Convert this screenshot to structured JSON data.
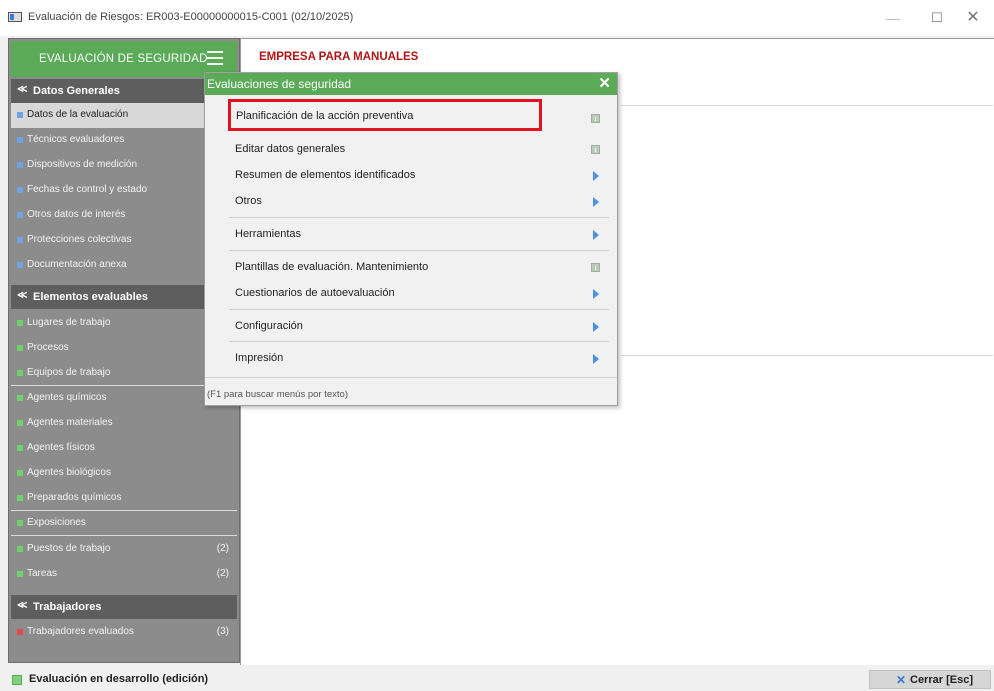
{
  "window": {
    "title": "Evaluación de Riesgos: ER003-E00000000015-C001  (02/10/2025)",
    "minimize": "—",
    "maximize": "☐",
    "close": "✕"
  },
  "sidebar": {
    "header_label": "EVALUACIÓN DE SEGURIDAD",
    "sections": {
      "datos_generales": "Datos Generales",
      "elementos": "Elementos evaluables",
      "trabajadores": "Trabajadores"
    },
    "chevron": "≪",
    "datos_generales_items": [
      {
        "label": "Datos de la evaluación",
        "color": "#6fa3e6"
      },
      {
        "label": "Técnicos evaluadores",
        "color": "#6fa3e6"
      },
      {
        "label": "Dispositivos de medición",
        "color": "#6fa3e6"
      },
      {
        "label": "Fechas de control y estado",
        "color": "#6fa3e6"
      },
      {
        "label": "Otros datos de interés",
        "color": "#6fa3e6"
      },
      {
        "label": "Protecciones colectivas",
        "color": "#6fa3e6"
      },
      {
        "label": "Documentación anexa",
        "color": "#6fa3e6"
      }
    ],
    "elementos_items": [
      {
        "label": "Lugares de trabajo",
        "count": ""
      },
      {
        "label": "Procesos",
        "count": ""
      },
      {
        "label": "Equipos de trabajo",
        "count": ""
      },
      {
        "label": "Agentes químicos",
        "count": ""
      },
      {
        "label": "Agentes materiales",
        "count": ""
      },
      {
        "label": "Agentes físicos",
        "count": ""
      },
      {
        "label": "Agentes biológicos",
        "count": ""
      },
      {
        "label": "Preparados químicos",
        "count": ""
      },
      {
        "label": "Exposiciones",
        "count": ""
      },
      {
        "label": "Puestos de trabajo",
        "count": "(2)"
      },
      {
        "label": "Tareas",
        "count": "(2)"
      }
    ],
    "trabajadores_items": [
      {
        "label": "Trabajadores evaluados",
        "count": "(3)"
      }
    ]
  },
  "main": {
    "company": "EMPRESA PARA MANUALES"
  },
  "popup": {
    "title": "Evaluaciones de seguridad",
    "close": "✕",
    "items": [
      {
        "label": "Planificación de la acción preventiva",
        "icon": "document-icon"
      },
      {
        "label": "Editar datos generales",
        "icon": "document-icon"
      },
      {
        "label": "Resumen de elementos identificados",
        "icon": "submenu-arrow-icon"
      },
      {
        "label": "Otros",
        "icon": "submenu-arrow-icon"
      },
      {
        "label": "Herramientas",
        "icon": "submenu-arrow-icon"
      },
      {
        "label": "Plantillas de evaluación. Mantenimiento",
        "icon": "document-icon"
      },
      {
        "label": "Cuestionarios de autoevaluación",
        "icon": "submenu-arrow-icon"
      },
      {
        "label": "Configuración",
        "icon": "submenu-arrow-icon"
      },
      {
        "label": "Impresión",
        "icon": "submenu-arrow-icon"
      }
    ],
    "hint": "(F1 para buscar menús por texto)"
  },
  "status": {
    "text": "Evaluación en desarrollo (edición)",
    "close_button": "Cerrar [Esc]"
  },
  "colors": {
    "accent_green": "#5aaa58",
    "highlight_red": "#e0141e",
    "company_red": "#b21515"
  }
}
